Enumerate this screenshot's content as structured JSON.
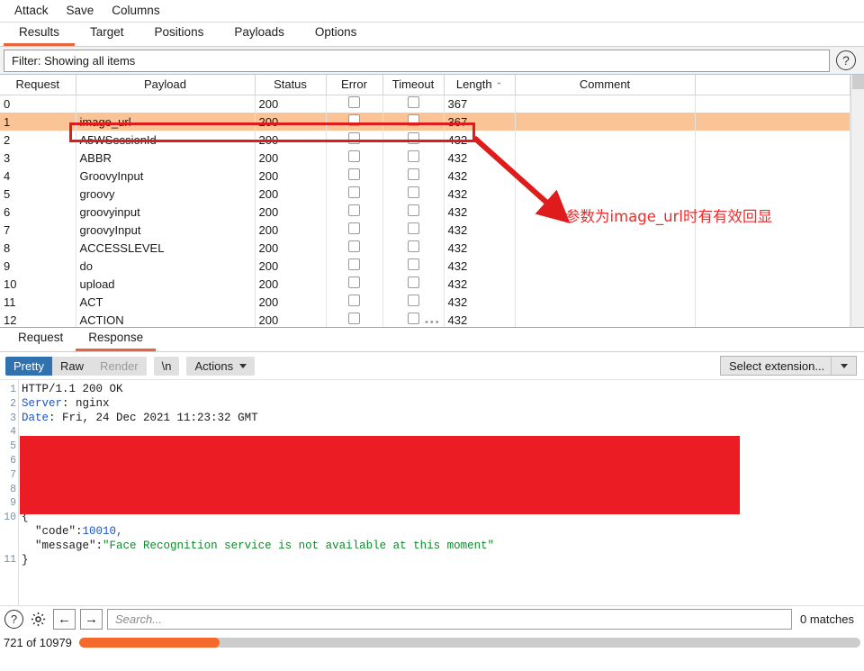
{
  "menu": {
    "items": [
      "Attack",
      "Save",
      "Columns"
    ]
  },
  "tabs": {
    "items": [
      "Results",
      "Target",
      "Positions",
      "Payloads",
      "Options"
    ],
    "active": "Results"
  },
  "filter": {
    "text": "Filter: Showing all items",
    "help_icon": "question-mark-icon"
  },
  "table": {
    "columns": [
      "Request",
      "Payload",
      "Status",
      "Error",
      "Timeout",
      "Length",
      "Comment",
      ""
    ],
    "sorted_column": "Length",
    "sort_caret": "⌃",
    "rows": [
      {
        "request": "0",
        "payload": "",
        "status": "200",
        "error": false,
        "timeout": false,
        "length": "367",
        "comment": "",
        "selected": false
      },
      {
        "request": "1",
        "payload": "image_url",
        "status": "200",
        "error": false,
        "timeout": false,
        "length": "367",
        "comment": "",
        "selected": true
      },
      {
        "request": "2",
        "payload": "A5WSessionId",
        "status": "200",
        "error": false,
        "timeout": false,
        "length": "432",
        "comment": "",
        "selected": false
      },
      {
        "request": "3",
        "payload": "ABBR",
        "status": "200",
        "error": false,
        "timeout": false,
        "length": "432",
        "comment": "",
        "selected": false
      },
      {
        "request": "4",
        "payload": "GroovyInput",
        "status": "200",
        "error": false,
        "timeout": false,
        "length": "432",
        "comment": "",
        "selected": false
      },
      {
        "request": "5",
        "payload": "groovy",
        "status": "200",
        "error": false,
        "timeout": false,
        "length": "432",
        "comment": "",
        "selected": false
      },
      {
        "request": "6",
        "payload": "groovyinput",
        "status": "200",
        "error": false,
        "timeout": false,
        "length": "432",
        "comment": "",
        "selected": false
      },
      {
        "request": "7",
        "payload": "groovyInput",
        "status": "200",
        "error": false,
        "timeout": false,
        "length": "432",
        "comment": "",
        "selected": false
      },
      {
        "request": "8",
        "payload": "ACCESSLEVEL",
        "status": "200",
        "error": false,
        "timeout": false,
        "length": "432",
        "comment": "",
        "selected": false
      },
      {
        "request": "9",
        "payload": "do",
        "status": "200",
        "error": false,
        "timeout": false,
        "length": "432",
        "comment": "",
        "selected": false
      },
      {
        "request": "10",
        "payload": "upload",
        "status": "200",
        "error": false,
        "timeout": false,
        "length": "432",
        "comment": "",
        "selected": false
      },
      {
        "request": "11",
        "payload": "ACT",
        "status": "200",
        "error": false,
        "timeout": false,
        "length": "432",
        "comment": "",
        "selected": false
      },
      {
        "request": "12",
        "payload": "ACTION",
        "status": "200",
        "error": false,
        "timeout": false,
        "length": "432",
        "comment": "",
        "selected": false
      }
    ]
  },
  "annotation": {
    "text": "参数为image_url时有有效回显",
    "color": "#ef2b2b",
    "box_color": "#e01b1b"
  },
  "message_tabs": {
    "items": [
      "Request",
      "Response"
    ],
    "active": "Response"
  },
  "viewer_toolbar": {
    "segments": [
      "Pretty",
      "Raw",
      "Render"
    ],
    "active_segment": "Pretty",
    "disabled_segment": "Render",
    "newline_button": "\\n",
    "actions_label": "Actions",
    "select_extension_label": "Select extension...",
    "caret_icon": "chevron-down-icon"
  },
  "response": {
    "line_numbers": [
      "1",
      "2",
      "3",
      "4",
      "5",
      "6",
      "7",
      "8",
      "9",
      "10",
      "11"
    ],
    "lines": [
      {
        "text": "HTTP/1.1 200 OK"
      },
      {
        "key": "Server",
        "value": " nginx"
      },
      {
        "key": "Date",
        "value": " Fri, 24 Dec 2021 11:23:32 GMT"
      },
      {
        "text": ""
      },
      {
        "text": ""
      },
      {
        "text": ""
      },
      {
        "text": ""
      },
      {
        "text": ""
      },
      {
        "text": ""
      },
      {
        "text": "{"
      },
      {
        "text": ""
      }
    ],
    "json_open": "{",
    "json_code_key": "\"code\"",
    "json_code_value": "10010,",
    "json_message_key": "\"message\"",
    "json_message_value": "\"Face Recognition service is not available at this moment\"",
    "json_close": "}",
    "redacted_block": true
  },
  "search": {
    "placeholder": "Search...",
    "value": "",
    "matches": "0 matches",
    "help_icon": "question-mark-icon",
    "settings_icon": "gear-icon",
    "back_icon": "←",
    "forward_icon": "→"
  },
  "status": {
    "text": "721 of 10979",
    "progress_percent": 18,
    "progress_color": "#f5692a"
  }
}
